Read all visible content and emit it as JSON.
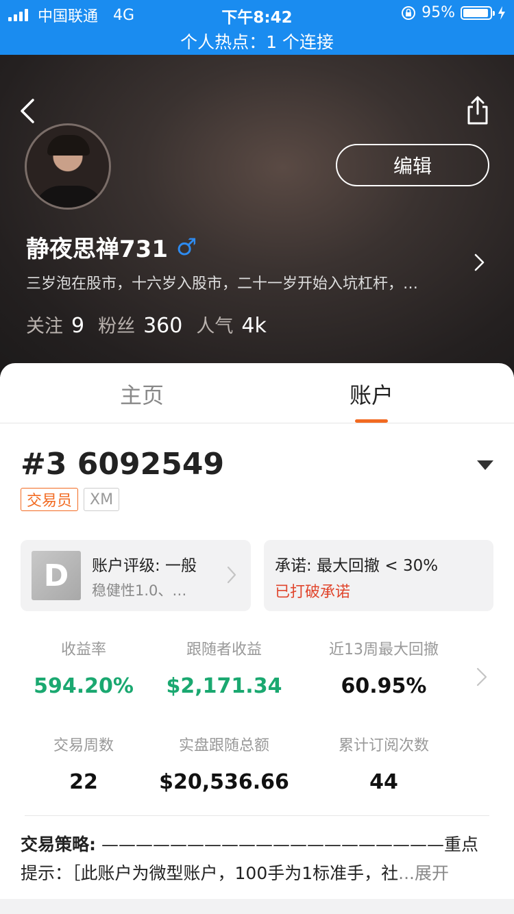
{
  "status_bar": {
    "carrier": "中国联通",
    "network": "4G",
    "time": "下午8:42",
    "battery_percent": "95%",
    "battery_level": 0.95,
    "hotspot_text": "个人热点：1 个连接",
    "color": "#1a8cf0"
  },
  "profile": {
    "back_icon": "chevron-left-icon",
    "share_icon": "share-icon",
    "edit_label": "编辑",
    "name": "静夜思禅731",
    "gender_symbol": "♂",
    "bio": "三岁泡在股市，十六岁入股市，二十一岁开始入坑杠杆，…",
    "stats": [
      {
        "label": "关注",
        "value": "9"
      },
      {
        "label": "粉丝",
        "value": "360"
      },
      {
        "label": "人气",
        "value": "4k"
      }
    ]
  },
  "tabs": [
    {
      "label": "主页",
      "active": false
    },
    {
      "label": "账户",
      "active": true
    }
  ],
  "accent_color": "#f26a21",
  "account": {
    "id": "#3 6092549",
    "badges": [
      "交易员",
      "XM"
    ],
    "rating": {
      "grade": "D",
      "title": "账户评级: 一般",
      "subtitle": "稳健性1.0、…"
    },
    "promise": {
      "title": "承诺: 最大回撤 < 30%",
      "status": "已打破承诺"
    },
    "metrics_row1": [
      {
        "label": "收益率",
        "value": "594.20%"
      },
      {
        "label": "跟随者收益",
        "value": "$2,171.34"
      },
      {
        "label": "近13周最大回撤",
        "value": "60.95%"
      }
    ],
    "metrics_row2": [
      {
        "label": "交易周数",
        "value": "22"
      },
      {
        "label": "实盘跟随总额",
        "value": "$20,536.66"
      },
      {
        "label": "累计订阅次数",
        "value": "44"
      }
    ],
    "strategy": {
      "label": "交易策略:",
      "text": " ————————————————————重点提示：［此账户为微型账户，100手为1标准手，社",
      "more": "...展开"
    }
  }
}
